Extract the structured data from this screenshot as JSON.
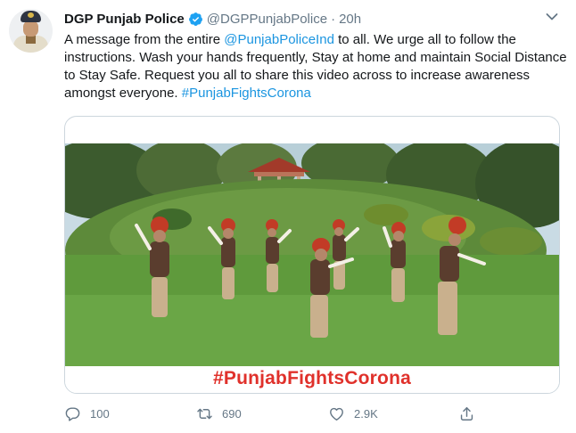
{
  "tweet": {
    "display_name": "DGP Punjab Police",
    "handle": "@DGPPunjabPolice",
    "separator": "·",
    "time": "20h",
    "text_part1": "A message from the entire ",
    "mention": "@PunjabPoliceInd",
    "text_part2": " to all. We urge all to follow the instructions. Wash your hands frequently, Stay at home and maintain Social Distance to Stay Safe. Request you all to share this video across to increase awareness amongst everyone. ",
    "hashtag": "#PunjabFightsCorona",
    "media": {
      "banner_text": "#PunjabFightsCorona"
    },
    "actions": {
      "replies": "100",
      "retweets": "690",
      "likes": "2.9K"
    }
  },
  "icons": {
    "verified": "verified-badge-icon",
    "caret": "chevron-down-icon",
    "reply": "reply-icon",
    "retweet": "retweet-icon",
    "like": "heart-icon",
    "share": "share-icon"
  },
  "colors": {
    "link": "#1b95e0",
    "text": "#14171a",
    "muted": "#657786",
    "banner_text": "#e0312b",
    "border": "#ccd6dd"
  }
}
